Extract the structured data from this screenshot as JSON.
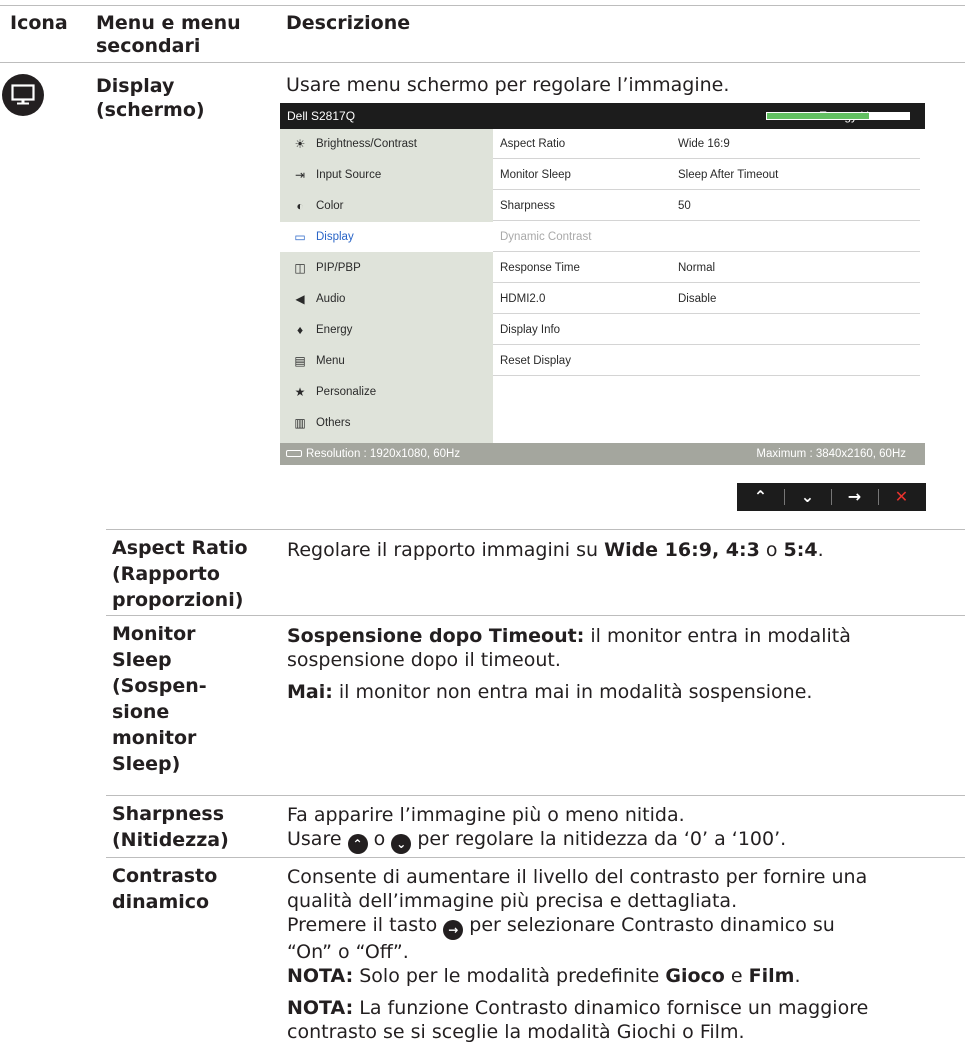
{
  "header": {
    "col_icon": "Icona",
    "col_menu_line1": "Menu e menu",
    "col_menu_line2": "secondari",
    "col_desc": "Descrizione"
  },
  "menu": {
    "title_line1": "Display",
    "title_line2": "(schermo)",
    "intro": "Usare menu schermo per regolare l’immagine.",
    "icon": "monitor-icon"
  },
  "osd": {
    "model": "Dell S2817Q",
    "energy_label": "Energy Use",
    "energy_level": 0.72,
    "left_items": [
      {
        "icon": "☀",
        "label": "Brightness/Contrast"
      },
      {
        "icon": "⇥",
        "label": "Input Source"
      },
      {
        "icon": "◐",
        "label": "Color"
      },
      {
        "icon": "▭",
        "label": "Display"
      },
      {
        "icon": "◫",
        "label": "PIP/PBP"
      },
      {
        "icon": "◀",
        "label": "Audio"
      },
      {
        "icon": "♦",
        "label": "Energy"
      },
      {
        "icon": "▤",
        "label": "Menu"
      },
      {
        "icon": "★",
        "label": "Personalize"
      },
      {
        "icon": "▥",
        "label": "Others"
      }
    ],
    "rows": [
      {
        "key": "Aspect Ratio",
        "value": "Wide 16:9"
      },
      {
        "key": "Monitor Sleep",
        "value": "Sleep After Timeout"
      },
      {
        "key": "Sharpness",
        "value": "50"
      },
      {
        "key": "Dynamic Contrast",
        "value": ""
      },
      {
        "key": "Response Time",
        "value": "Normal"
      },
      {
        "key": "HDMI2.0",
        "value": "Disable"
      },
      {
        "key": "Display Info",
        "value": ""
      },
      {
        "key": "Reset Display",
        "value": ""
      }
    ],
    "resolution": "Resolution : 1920x1080, 60Hz",
    "maximum": "Maximum : 3840x2160, 60Hz",
    "nav": {
      "up": "⌃",
      "down": "⌄",
      "next": "→",
      "exit": "✕"
    }
  },
  "entries": {
    "aspect": {
      "term": [
        "Aspect Ratio",
        "(Rapporto",
        "proporzioni)"
      ],
      "t1": "Regolare il rapporto immagini su ",
      "b1": "Wide 16:9, 4:3",
      "t2": " o ",
      "b2": "5:4",
      "t3": "."
    },
    "sleep": {
      "term": [
        "Monitor",
        "Sleep",
        "(Sospen-",
        "sione",
        "monitor",
        "Sleep)"
      ],
      "p1_bold": "Sospensione dopo Timeout:",
      "p1_line1": " il monitor entra in modalità",
      "p1_line2": "sospensione dopo il timeout.",
      "p2_bold": "Mai:",
      "p2_text": " il monitor non entra mai in modalità sospensione."
    },
    "sharpness": {
      "term": [
        "Sharpness",
        "(Nitidezza)"
      ],
      "line1": "Fa apparire l’immagine più o meno nitida.",
      "l2_a": "Usare ",
      "l2_b": " o ",
      "l2_c": " per regolare la nitidezza da ‘0’ a ‘100’."
    },
    "contrast": {
      "term": [
        "Contrasto",
        "dinamico"
      ],
      "line1": "Consente di aumentare il livello del contrasto per fornire una",
      "line2": "qualità dell’immagine più precisa e dettagliata.",
      "l3_a": "Premere il tasto ",
      "l3_b": " per selezionare Contrasto dinamico su",
      "line4": "“On” o “Off”.",
      "n1_bold": "NOTA:",
      "n1_text": " Solo per le modalità predefinite ",
      "n1_b2": "Gioco",
      "n1_t2": " e ",
      "n1_b3": "Film",
      "n1_t3": ".",
      "n2_bold": "NOTA:",
      "n2_line1": " La funzione Contrasto dinamico fornisce un maggiore",
      "n2_line2": "contrasto se si sceglie la modalità Giochi o Film."
    }
  }
}
